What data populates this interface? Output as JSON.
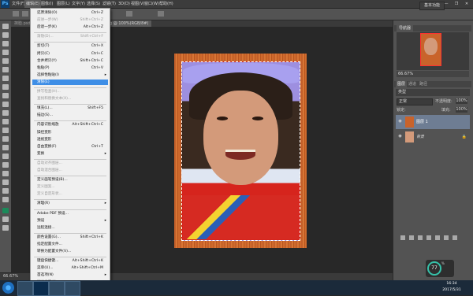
{
  "app": {
    "logo": "Ps"
  },
  "menubar": {
    "items": [
      "文件(F)",
      "编辑(E)",
      "图像(I)",
      "图层(L)",
      "文字(Y)",
      "选择(S)",
      "滤镜(T)",
      "3D(D)",
      "视图(V)",
      "窗口(W)",
      "帮助(H)"
    ]
  },
  "window_controls": {
    "minimize": "—",
    "restore": "❐",
    "close": "✕"
  },
  "optionsbar": {
    "workspace": "基本功能"
  },
  "document": {
    "tab": "IMG_1924.jpg @ 100%(RGB/8#)",
    "tab_left": "抹脸.psd"
  },
  "status": {
    "zoom": "66.67%"
  },
  "edit_menu": {
    "items": [
      {
        "label": "还原清除(O)",
        "shortcut": "Ctrl+Z",
        "disabled": false
      },
      {
        "label": "前进一步(W)",
        "shortcut": "Shift+Ctrl+Z",
        "disabled": true
      },
      {
        "label": "后退一步(K)",
        "shortcut": "Alt+Ctrl+Z",
        "disabled": false
      },
      {
        "label": "渐隐(D)...",
        "shortcut": "Shift+Ctrl+F",
        "disabled": true
      },
      {
        "label": "剪切(T)",
        "shortcut": "Ctrl+X",
        "disabled": false
      },
      {
        "label": "拷贝(C)",
        "shortcut": "Ctrl+C",
        "disabled": false
      },
      {
        "label": "合并拷贝(Y)",
        "shortcut": "Shift+Ctrl+C",
        "disabled": false
      },
      {
        "label": "粘贴(P)",
        "shortcut": "Ctrl+V",
        "disabled": false
      },
      {
        "label": "选择性粘贴(I)",
        "shortcut": "",
        "disabled": false,
        "submenu": true
      },
      {
        "label": "清除(E)",
        "shortcut": "",
        "disabled": false,
        "selected": true
      },
      {
        "label": "拼写检查(H)...",
        "shortcut": "",
        "disabled": true
      },
      {
        "label": "查找和替换文本(X)...",
        "shortcut": "",
        "disabled": true
      },
      {
        "label": "填充(L)...",
        "shortcut": "Shift+F5",
        "disabled": false
      },
      {
        "label": "描边(S)...",
        "shortcut": "",
        "disabled": false
      },
      {
        "label": "内容识别缩放",
        "shortcut": "Alt+Shift+Ctrl+C",
        "disabled": false
      },
      {
        "label": "操控变形",
        "shortcut": "",
        "disabled": false
      },
      {
        "label": "透视变形",
        "shortcut": "",
        "disabled": false
      },
      {
        "label": "自由变换(F)",
        "shortcut": "Ctrl+T",
        "disabled": false
      },
      {
        "label": "变换",
        "shortcut": "",
        "disabled": false,
        "submenu": true
      },
      {
        "label": "自动对齐图层...",
        "shortcut": "",
        "disabled": true
      },
      {
        "label": "自动混合图层...",
        "shortcut": "",
        "disabled": true
      },
      {
        "label": "定义画笔预设(B)...",
        "shortcut": "",
        "disabled": false
      },
      {
        "label": "定义图案...",
        "shortcut": "",
        "disabled": true
      },
      {
        "label": "定义自定形状...",
        "shortcut": "",
        "disabled": true
      },
      {
        "label": "清理(R)",
        "shortcut": "",
        "disabled": false,
        "submenu": true
      },
      {
        "label": "Adobe PDF 预设...",
        "shortcut": "",
        "disabled": false
      },
      {
        "label": "预设",
        "shortcut": "",
        "disabled": false,
        "submenu": true
      },
      {
        "label": "远程连接...",
        "shortcut": "",
        "disabled": false
      },
      {
        "label": "颜色设置(G)...",
        "shortcut": "Shift+Ctrl+K",
        "disabled": false
      },
      {
        "label": "指定配置文件...",
        "shortcut": "",
        "disabled": false
      },
      {
        "label": "转换为配置文件(V)...",
        "shortcut": "",
        "disabled": false
      },
      {
        "label": "键盘快捷键...",
        "shortcut": "Alt+Shift+Ctrl+K",
        "disabled": false
      },
      {
        "label": "菜单(U)...",
        "shortcut": "Alt+Shift+Ctrl+M",
        "disabled": false
      },
      {
        "label": "首选项(N)",
        "shortcut": "",
        "disabled": false,
        "submenu": true
      },
      {
        "label": "同步设置(E)",
        "shortcut": "",
        "disabled": true,
        "submenu": true
      }
    ],
    "submenu_arrow": "▸"
  },
  "navigator": {
    "tab": "导航器",
    "zoom": "66.67%"
  },
  "layers_panel": {
    "tabs": [
      "图层",
      "通道",
      "路径"
    ],
    "kind": "类型",
    "blend_mode": "正常",
    "opacity_label": "不透明度:",
    "opacity_value": "100%",
    "lock_label": "锁定:",
    "fill_label": "填充:",
    "fill_value": "100%",
    "layers": [
      {
        "name": "图层 1",
        "active": true
      },
      {
        "name": "背景",
        "active": false,
        "locked": true
      }
    ],
    "eye_glyph": "◉",
    "lock_glyph": "🔒"
  },
  "widget": {
    "value": "77",
    "unit": "%"
  },
  "taskbar": {
    "time": "16:34",
    "date": "2017/5/31"
  }
}
